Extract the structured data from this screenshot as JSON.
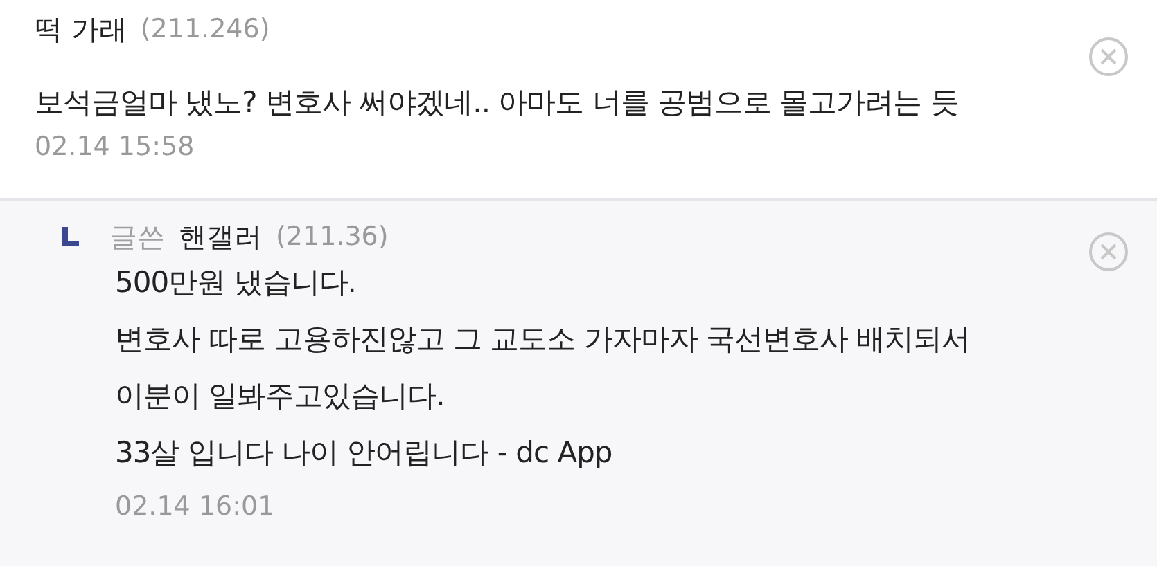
{
  "comments": [
    {
      "kind": "comment",
      "author": "떡 가래",
      "ip": "(211.246)",
      "lines": [
        "보석금얼마 냈노? 변호사 써야겠네.. 아마도 너를 공범으로 몰고가려는 듯"
      ],
      "time": "02.14 15:58"
    },
    {
      "kind": "reply",
      "badge": "글쓴",
      "author": "핸갤러",
      "ip": "(211.36)",
      "lines": [
        "500만원 냈습니다.",
        "변호사 따로 고용하진않고 그 교도소 가자마자 국선변호사 배치되서",
        "이분이 일봐주고있습니다.",
        "33살 입니다 나이 안어립니다 - dc App"
      ],
      "time": "02.14 16:01"
    }
  ]
}
